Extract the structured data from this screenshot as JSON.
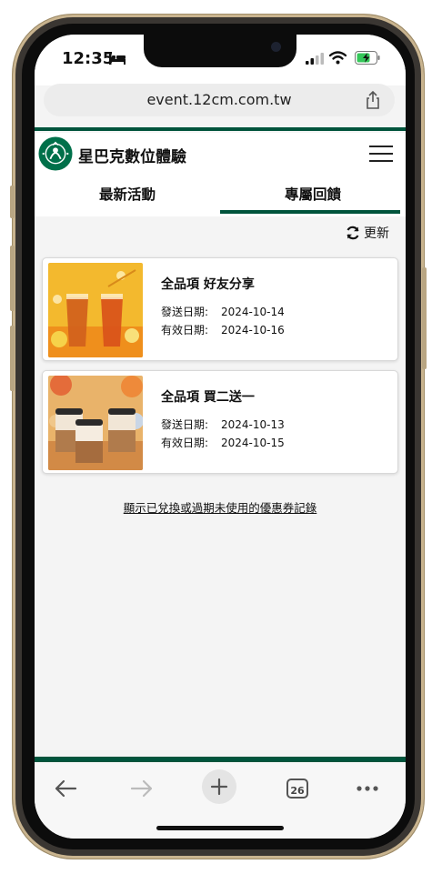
{
  "status_bar": {
    "time": "12:35"
  },
  "browser": {
    "url": "event.12cm.com.tw",
    "tab_count": "26"
  },
  "header": {
    "brand": "星巴克數位體驗"
  },
  "tabs": [
    {
      "label": "最新活動"
    },
    {
      "label": "專屬回饋"
    }
  ],
  "refresh_label": "更新",
  "coupons": [
    {
      "title": "全品項 好友分享",
      "issue_label": "發送日期:",
      "issue_date": "2024-10-14",
      "expiry_label": "有效日期:",
      "expiry_date": "2024-10-16"
    },
    {
      "title": "全品項 買二送一",
      "issue_label": "發送日期:",
      "issue_date": "2024-10-13",
      "expiry_label": "有效日期:",
      "expiry_date": "2024-10-15"
    }
  ],
  "history_link": "顯示已兌換或過期未使用的優惠券記錄",
  "colors": {
    "brand_green": "#00543c"
  },
  "icons": [
    "bed-icon",
    "signal-icon",
    "wifi-icon",
    "battery-charging-icon",
    "share-icon",
    "starbucks-logo",
    "hamburger-menu-icon",
    "refresh-icon",
    "back-arrow-icon",
    "forward-arrow-icon",
    "plus-icon",
    "tabs-icon",
    "more-icon"
  ]
}
